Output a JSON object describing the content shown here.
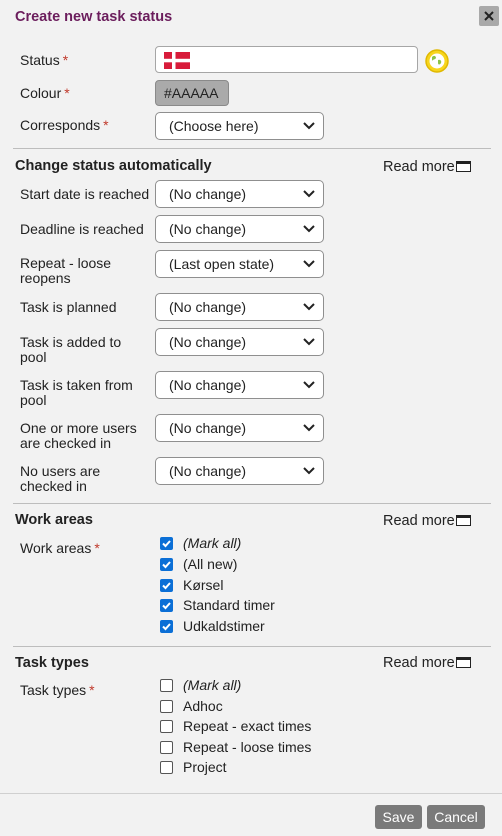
{
  "dialog": {
    "title": "Create new task status",
    "close_icon": "close-icon"
  },
  "form": {
    "status_label": "Status",
    "status_value": "",
    "status_flag": "denmark-flag",
    "colour_label": "Colour",
    "colour_value": "#AAAAA",
    "colour_swatch": "#aaaaaa",
    "corresponds_label": "Corresponds",
    "corresponds_value": "(Choose here)",
    "required_mark": "*"
  },
  "auto": {
    "title": "Change status automatically",
    "read_more": "Read more",
    "rows": [
      {
        "label": "Start date is reached",
        "value": "(No change)"
      },
      {
        "label": "Deadline is reached",
        "value": "(No change)"
      },
      {
        "label": "Repeat - loose reopens",
        "value": "(Last open state)"
      },
      {
        "label": "Task is planned",
        "value": "(No change)"
      },
      {
        "label": "Task is added to pool",
        "value": "(No change)"
      },
      {
        "label": "Task is taken from pool",
        "value": "(No change)"
      },
      {
        "label": "One or more users are checked in",
        "value": "(No change)"
      },
      {
        "label": "No users are checked in",
        "value": "(No change)"
      }
    ]
  },
  "work_areas": {
    "title": "Work areas",
    "read_more": "Read more",
    "field_label": "Work areas",
    "items": [
      {
        "label": "(Mark all)",
        "checked": true
      },
      {
        "label": "(All new)",
        "checked": true
      },
      {
        "label": "Kørsel",
        "checked": true
      },
      {
        "label": "Standard timer",
        "checked": true
      },
      {
        "label": "Udkaldstimer",
        "checked": true
      }
    ]
  },
  "task_types": {
    "title": "Task types",
    "read_more": "Read more",
    "field_label": "Task types",
    "items": [
      {
        "label": "(Mark all)",
        "checked": false
      },
      {
        "label": "Adhoc",
        "checked": false
      },
      {
        "label": "Repeat - exact times",
        "checked": false
      },
      {
        "label": "Repeat - loose times",
        "checked": false
      },
      {
        "label": "Project",
        "checked": false
      }
    ]
  },
  "footer": {
    "save_label": "Save",
    "cancel_label": "Cancel"
  },
  "colors": {
    "title": "#6b1d5c",
    "checkbox": "#0b6fd6",
    "button": "#7a7a7a",
    "required": "#c0392b"
  }
}
